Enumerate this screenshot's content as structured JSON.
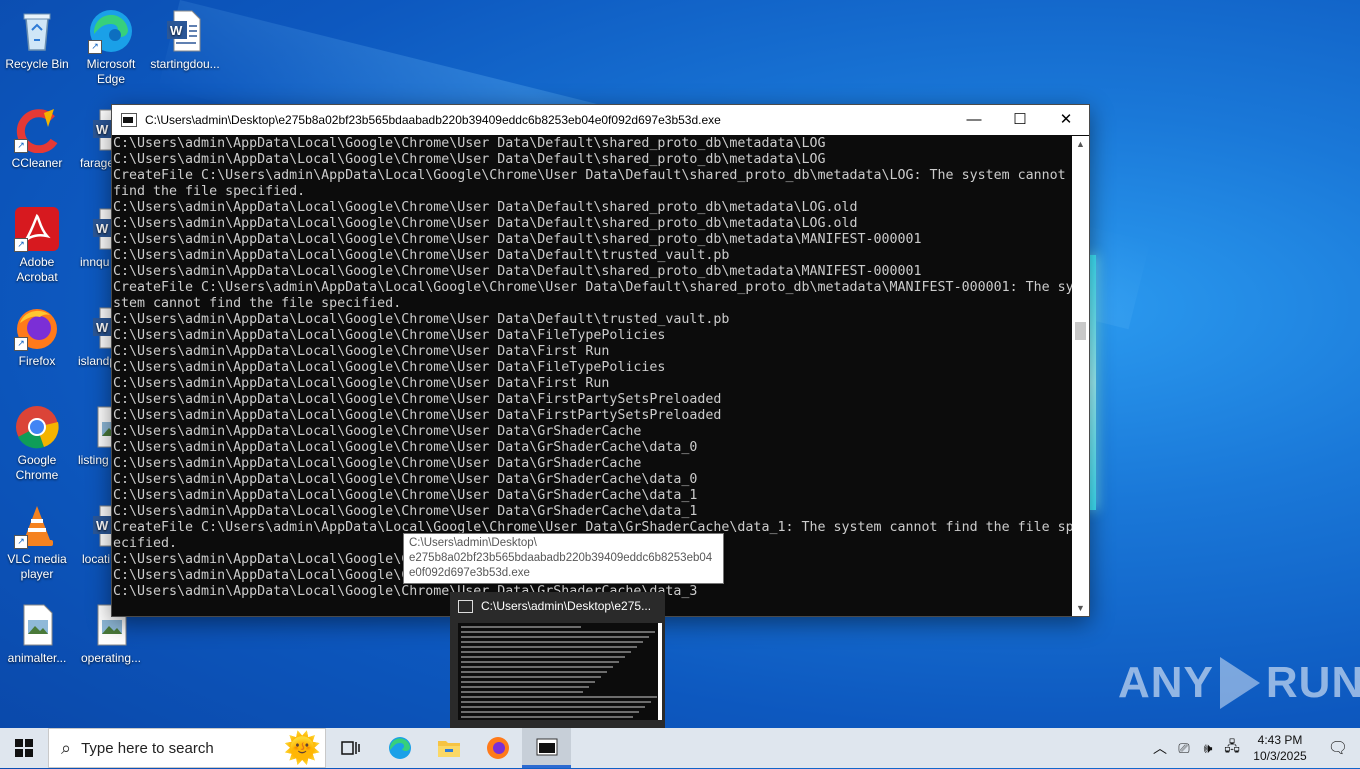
{
  "desktop": {
    "icons": [
      {
        "label": "Recycle Bin",
        "icon": "recycle-bin-icon"
      },
      {
        "label": "Microsoft Edge",
        "icon": "edge-icon"
      },
      {
        "label": "startingdou...",
        "icon": "word-doc-icon"
      },
      {
        "label": "CCleaner",
        "icon": "ccleaner-icon"
      },
      {
        "label": "farage",
        "icon": "word-doc-icon"
      },
      {
        "label": "Adobe Acrobat",
        "icon": "acrobat-icon"
      },
      {
        "label": "innqu",
        "icon": "word-doc-icon"
      },
      {
        "label": "Firefox",
        "icon": "firefox-icon"
      },
      {
        "label": "islandp",
        "icon": "word-doc-icon"
      },
      {
        "label": "Google Chrome",
        "icon": "chrome-icon"
      },
      {
        "label": "listing",
        "icon": "image-file-icon"
      },
      {
        "label": "VLC media player",
        "icon": "vlc-icon"
      },
      {
        "label": "locati",
        "icon": "word-doc-icon"
      },
      {
        "label": "animalter...",
        "icon": "image-file-icon"
      },
      {
        "label": "operating...",
        "icon": "image-file-icon"
      }
    ]
  },
  "window": {
    "title": "C:\\Users\\admin\\Desktop\\e275b8a02bf23b565bdaabadb220b39409eddc6b8253eb04e0f092d697e3b53d.exe",
    "minimize": "—",
    "maximize": "☐",
    "close": "✕"
  },
  "console": {
    "lines": [
      "C:\\Users\\admin\\AppData\\Local\\Google\\Chrome\\User Data\\Default\\shared_proto_db\\metadata\\LOG",
      "C:\\Users\\admin\\AppData\\Local\\Google\\Chrome\\User Data\\Default\\shared_proto_db\\metadata\\LOG",
      "CreateFile C:\\Users\\admin\\AppData\\Local\\Google\\Chrome\\User Data\\Default\\shared_proto_db\\metadata\\LOG: The system cannot",
      "find the file specified.",
      "C:\\Users\\admin\\AppData\\Local\\Google\\Chrome\\User Data\\Default\\shared_proto_db\\metadata\\LOG.old",
      "C:\\Users\\admin\\AppData\\Local\\Google\\Chrome\\User Data\\Default\\shared_proto_db\\metadata\\LOG.old",
      "C:\\Users\\admin\\AppData\\Local\\Google\\Chrome\\User Data\\Default\\shared_proto_db\\metadata\\MANIFEST-000001",
      "C:\\Users\\admin\\AppData\\Local\\Google\\Chrome\\User Data\\Default\\trusted_vault.pb",
      "C:\\Users\\admin\\AppData\\Local\\Google\\Chrome\\User Data\\Default\\shared_proto_db\\metadata\\MANIFEST-000001",
      "CreateFile C:\\Users\\admin\\AppData\\Local\\Google\\Chrome\\User Data\\Default\\shared_proto_db\\metadata\\MANIFEST-000001: The sy",
      "stem cannot find the file specified.",
      "C:\\Users\\admin\\AppData\\Local\\Google\\Chrome\\User Data\\Default\\trusted_vault.pb",
      "C:\\Users\\admin\\AppData\\Local\\Google\\Chrome\\User Data\\FileTypePolicies",
      "C:\\Users\\admin\\AppData\\Local\\Google\\Chrome\\User Data\\First Run",
      "C:\\Users\\admin\\AppData\\Local\\Google\\Chrome\\User Data\\FileTypePolicies",
      "C:\\Users\\admin\\AppData\\Local\\Google\\Chrome\\User Data\\First Run",
      "C:\\Users\\admin\\AppData\\Local\\Google\\Chrome\\User Data\\FirstPartySetsPreloaded",
      "C:\\Users\\admin\\AppData\\Local\\Google\\Chrome\\User Data\\FirstPartySetsPreloaded",
      "C:\\Users\\admin\\AppData\\Local\\Google\\Chrome\\User Data\\GrShaderCache",
      "C:\\Users\\admin\\AppData\\Local\\Google\\Chrome\\User Data\\GrShaderCache\\data_0",
      "C:\\Users\\admin\\AppData\\Local\\Google\\Chrome\\User Data\\GrShaderCache",
      "C:\\Users\\admin\\AppData\\Local\\Google\\Chrome\\User Data\\GrShaderCache\\data_0",
      "C:\\Users\\admin\\AppData\\Local\\Google\\Chrome\\User Data\\GrShaderCache\\data_1",
      "C:\\Users\\admin\\AppData\\Local\\Google\\Chrome\\User Data\\GrShaderCache\\data_1",
      "CreateFile C:\\Users\\admin\\AppData\\Local\\Google\\Chrome\\User Data\\GrShaderCache\\data_1: The system cannot find the file sp",
      "ecified.",
      "C:\\Users\\admin\\AppData\\Local\\Google\\C",
      "C:\\Users\\admin\\AppData\\Local\\Google\\C",
      "C:\\Users\\admin\\AppData\\Local\\Google\\Chrome\\User Data\\GrShaderCache\\data_3"
    ]
  },
  "tooltip": {
    "lines": [
      "C:\\Users\\admin\\Desktop\\",
      "e275b8a02bf23b565bdaabadb220b39409eddc6b8253eb04",
      "e0f092d697e3b53d.exe"
    ]
  },
  "taskbar_preview": {
    "title": "C:\\Users\\admin\\Desktop\\e275..."
  },
  "watermark": {
    "left": "ANY",
    "right": "RUN"
  },
  "taskbar": {
    "search_placeholder": "Type here to search",
    "apps": [
      "task-view-icon",
      "edge-icon",
      "file-explorer-icon",
      "firefox-icon",
      "console-app-icon"
    ],
    "clock_time": "4:43 PM",
    "clock_date": "10/3/2025"
  }
}
